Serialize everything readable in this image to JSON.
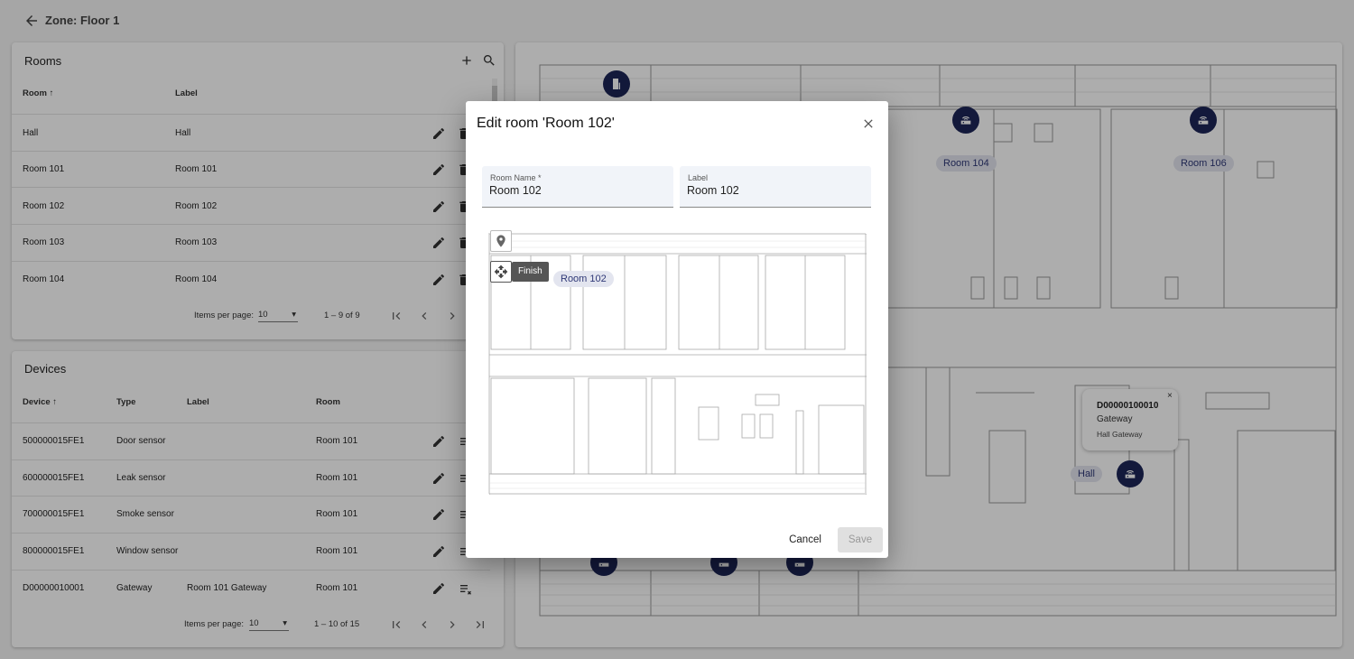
{
  "zone": {
    "title": "Zone: Floor 1"
  },
  "rooms": {
    "title": "Rooms",
    "columns": {
      "room": "Room",
      "label": "Label"
    },
    "rows": [
      {
        "room": "Hall",
        "label": "Hall"
      },
      {
        "room": "Room 101",
        "label": "Room 101"
      },
      {
        "room": "Room 102",
        "label": "Room 102"
      },
      {
        "room": "Room 103",
        "label": "Room 103"
      },
      {
        "room": "Room 104",
        "label": "Room 104"
      }
    ],
    "paginator": {
      "items_per_page_label": "Items per page:",
      "page_size": "10",
      "range": "1 – 9 of 9"
    }
  },
  "devices": {
    "title": "Devices",
    "columns": {
      "device": "Device",
      "type": "Type",
      "label": "Label",
      "room": "Room"
    },
    "rows": [
      {
        "device": "500000015FE1",
        "type": "Door sensor",
        "label": "",
        "room": "Room 101"
      },
      {
        "device": "600000015FE1",
        "type": "Leak sensor",
        "label": "",
        "room": "Room 101"
      },
      {
        "device": "700000015FE1",
        "type": "Smoke sensor",
        "label": "",
        "room": "Room 101"
      },
      {
        "device": "800000015FE1",
        "type": "Window sensor",
        "label": "",
        "room": "Room 101"
      },
      {
        "device": "D00000010001",
        "type": "Gateway",
        "label": "Room 101 Gateway",
        "room": "Room 101"
      }
    ],
    "paginator": {
      "items_per_page_label": "Items per page:",
      "page_size": "10",
      "range": "1 – 10 of 15"
    }
  },
  "floorplan": {
    "room_labels": {
      "room_104": "Room 104",
      "room_106": "Room 106",
      "hall": "Hall"
    },
    "popup": {
      "device_id": "D00000100010",
      "type": "Gateway",
      "label": "Hall Gateway"
    },
    "marker_color": "#1d2657"
  },
  "dialog": {
    "title": "Edit room 'Room 102'",
    "room_name_label": "Room Name *",
    "room_name_value": "Room 102",
    "label_label": "Label",
    "label_value": "Room 102",
    "finish_tooltip": "Finish",
    "room_pill": "Room 102",
    "cancel_label": "Cancel",
    "save_label": "Save"
  },
  "icons": [
    "back-arrow-icon",
    "plus-icon",
    "search-icon",
    "pencil-icon",
    "trash-icon",
    "unlink-icon",
    "first-page-icon",
    "prev-page-icon",
    "next-page-icon",
    "last-page-icon",
    "close-icon",
    "pin-icon",
    "move-icon",
    "gateway-icon",
    "building-icon"
  ],
  "colors": {
    "accent": "#1d2657",
    "pill_bg": "#e3e5ef"
  }
}
